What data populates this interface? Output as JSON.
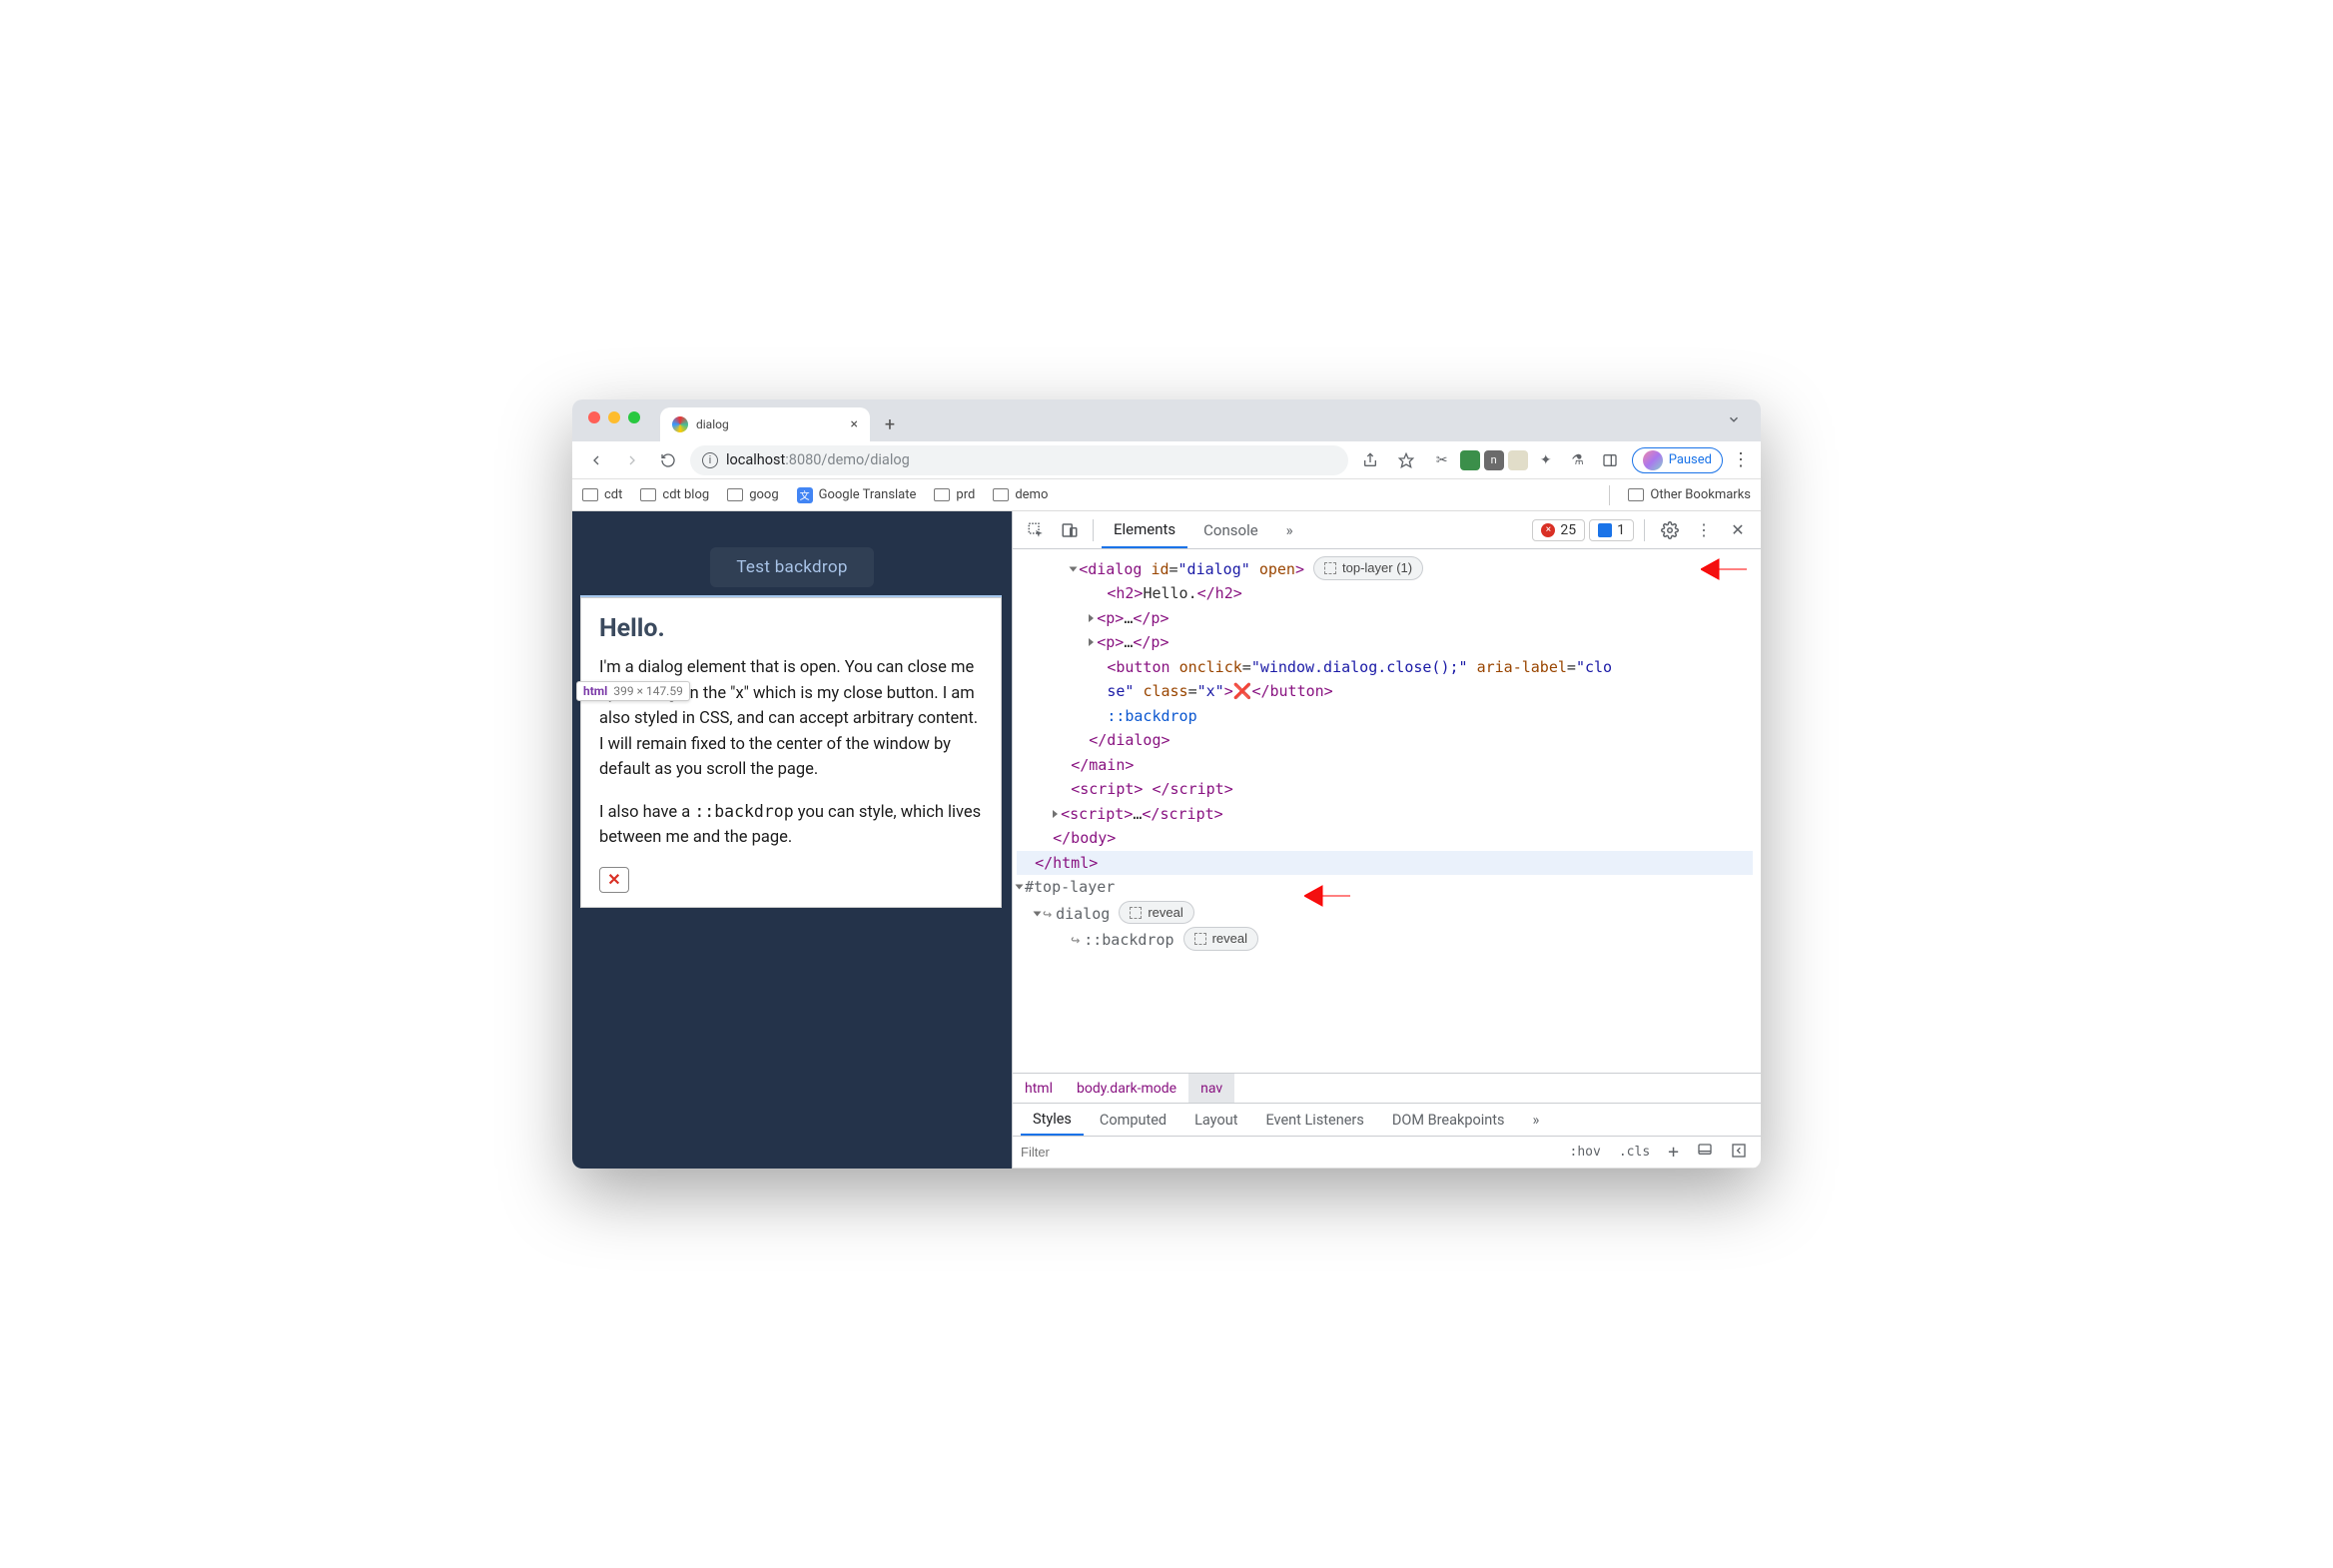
{
  "browser": {
    "tab_title": "dialog",
    "url_display_prefix": "localhost",
    "url_display_port": ":8080",
    "url_display_path": "/demo/dialog",
    "paused_label": "Paused"
  },
  "bookmarks": {
    "items": [
      "cdt",
      "cdt blog",
      "goog",
      "Google Translate",
      "prd",
      "demo"
    ],
    "other": "Other Bookmarks"
  },
  "page": {
    "test_button": "Test backdrop",
    "dialog_heading": "Hello.",
    "dialog_p1": "I'm a dialog element that is open. You can close me by clicking on the \"x\" which is my close button. I am also styled in CSS, and can accept arbitrary content. I will remain fixed to the center of the window by default as you scroll the page.",
    "dialog_p2_a": "I also have a ",
    "dialog_p2_code": "::backdrop",
    "dialog_p2_b": " you can style, which lives between me and the page.",
    "inspector_tip_tag": "html",
    "inspector_tip_dim": "399 × 147.59"
  },
  "devtools": {
    "tabs": {
      "elements": "Elements",
      "console": "Console",
      "more": "»"
    },
    "error_count": "25",
    "message_count": "1",
    "top_layer_badge": "top-layer (1)",
    "reveal_label": "reveal",
    "tree": {
      "dialog_open": "<dialog id=\"dialog\" open>",
      "h2": "<h2>Hello.</h2>",
      "p": "<p>…</p>",
      "button1": "<button onclick=\"window.dialog.close();\" aria-label=\"clo",
      "button2": "se\" class=\"x\">❌</button>",
      "backdrop": "::backdrop",
      "dialog_close": "</dialog>",
      "main_close": "</main>",
      "script_empty": "<script> </script>",
      "script_dots": "<script>…</script>",
      "body_close": "</body>",
      "html_close": "</html>",
      "top_layer_head": "#top-layer",
      "tl_dialog": "dialog",
      "tl_backdrop": "::backdrop"
    },
    "breadcrumb": [
      "html",
      "body.dark-mode",
      "nav"
    ],
    "subtabs": [
      "Styles",
      "Computed",
      "Layout",
      "Event Listeners",
      "DOM Breakpoints",
      "»"
    ],
    "filter_placeholder": "Filter",
    "tools": {
      "hov": ":hov",
      "cls": ".cls",
      "plus": "+"
    }
  }
}
